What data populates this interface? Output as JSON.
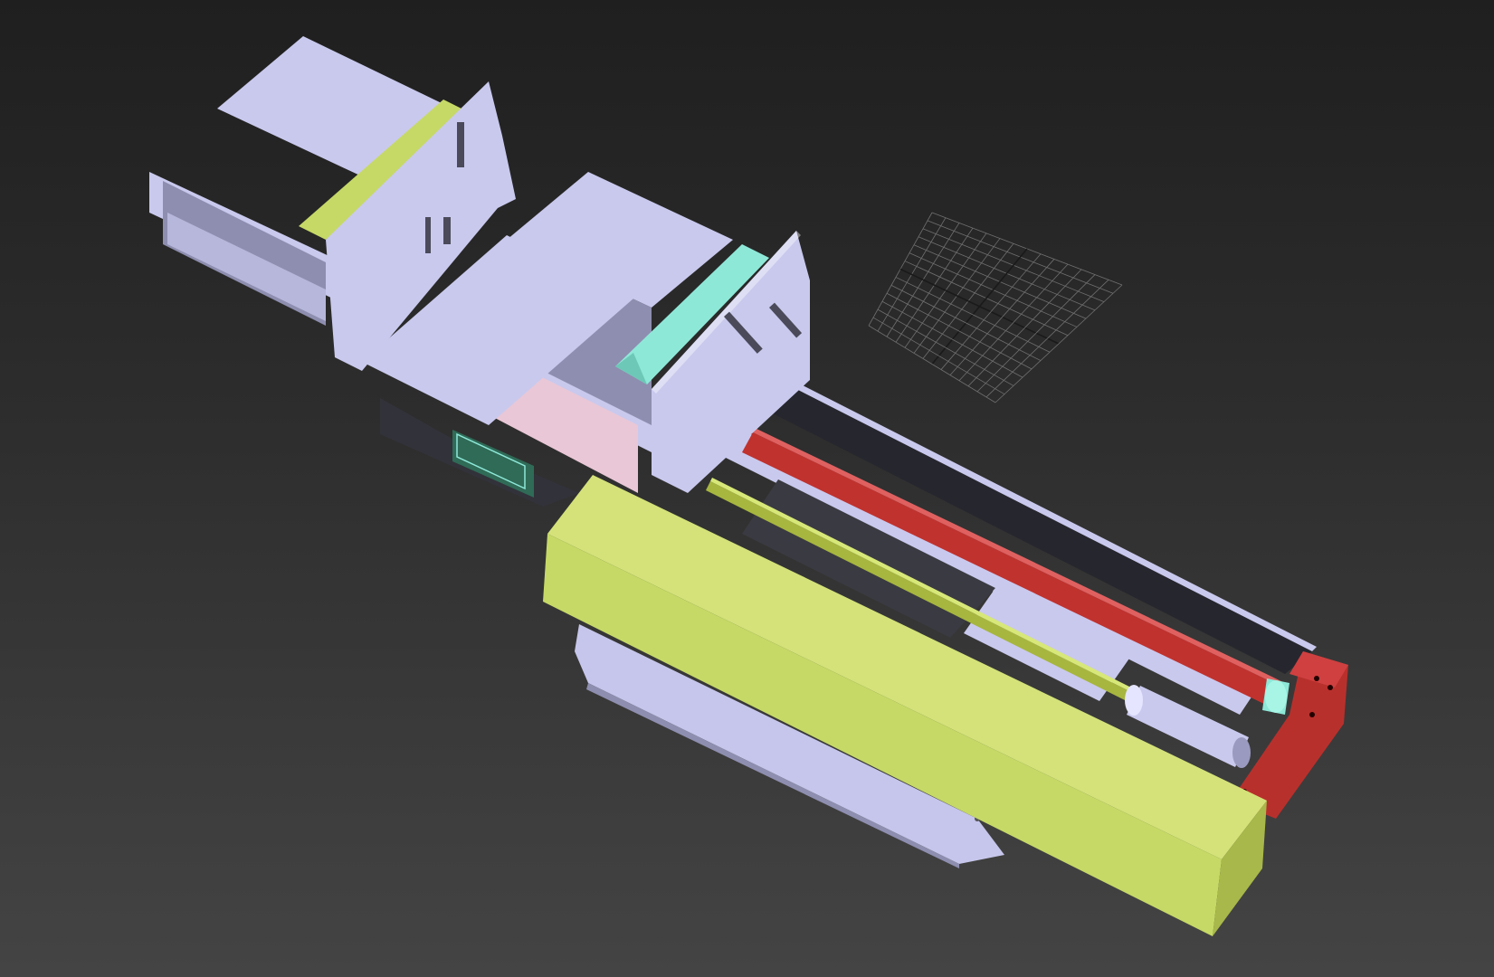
{
  "viewport": {
    "background_top": "#1f1f1f",
    "background_bottom": "#444444",
    "grid_color": "#6f6f6f",
    "grid_axis_color": "#1a1a1a"
  },
  "materials": {
    "frame": "#c9c9ee",
    "frame_shadow": "#8e8eb0",
    "frame_dark": "#6e6e8c",
    "yellow_green": "#c6d966",
    "yellow_green_dark": "#8f9b3c",
    "red_rod": "#c0322e",
    "red_block": "#b8302c",
    "teal": "#8ee8d8",
    "pink": "#e9c7d6",
    "dark_channel": "#26262e",
    "green_plate": "#2f6b57"
  }
}
